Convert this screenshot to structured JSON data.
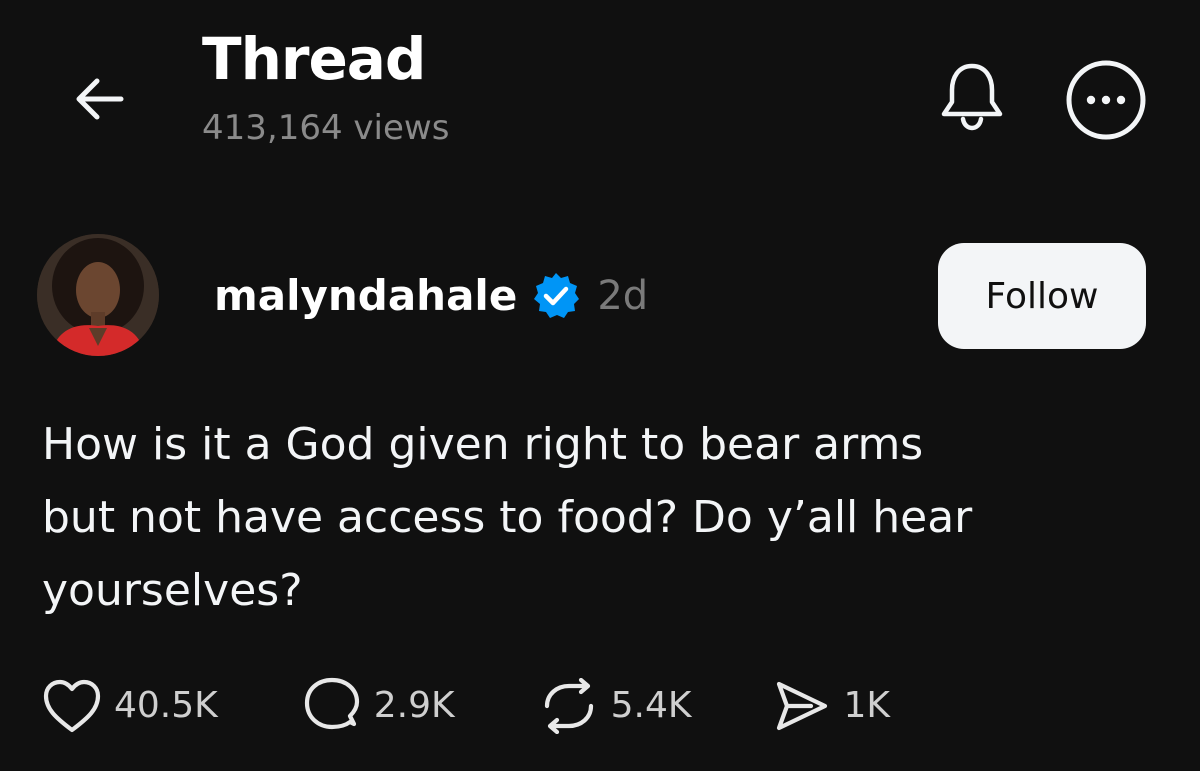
{
  "header": {
    "title": "Thread",
    "views": "413,164 views",
    "icons": {
      "back": "back-arrow-icon",
      "notifications": "bell-icon",
      "more": "more-options-icon"
    }
  },
  "post": {
    "author": {
      "username": "malyndahale",
      "verified": true,
      "timestamp": "2d"
    },
    "follow_label": "Follow",
    "text": "How is it a God given right to bear arms\nbut not have access to food? Do y’all hear\nyourselves?",
    "actions": {
      "likes": "40.5K",
      "replies": "2.9K",
      "reposts": "5.4K",
      "shares": "1K"
    }
  },
  "colors": {
    "background": "#101010",
    "text_primary": "#f3f5f7",
    "text_muted": "#7a7a7a",
    "verified_blue": "#0095f6",
    "follow_bg": "#f3f5f7"
  }
}
